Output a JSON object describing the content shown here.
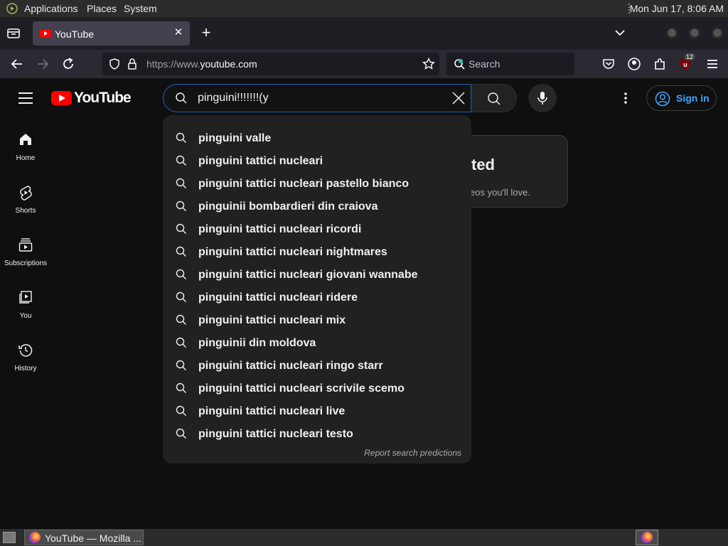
{
  "top_panel": {
    "menus": [
      "Applications",
      "Places",
      "System"
    ],
    "clock": "Mon Jun 17,  8:06 AM"
  },
  "browser": {
    "tab_title": "YouTube",
    "url_prefix": "https://www.",
    "url_domain": "youtube.com",
    "search_placeholder": "Search",
    "extension_badge": "12"
  },
  "youtube": {
    "logo_text": "YouTube",
    "search_value": "pinguini!!!!!!!(y",
    "sign_in_label": "Sign in",
    "sidebar": [
      {
        "label": "Home",
        "icon": "home-icon"
      },
      {
        "label": "Shorts",
        "icon": "shorts-icon"
      },
      {
        "label": "Subscriptions",
        "icon": "subscriptions-icon"
      },
      {
        "label": "You",
        "icon": "you-icon"
      },
      {
        "label": "History",
        "icon": "history-icon"
      }
    ],
    "card": {
      "heading_fragment": "ted",
      "text_fragment": "eos you'll love."
    },
    "suggestions": [
      "pinguini valle",
      "pinguini tattici nucleari",
      "pinguini tattici nucleari pastello bianco",
      "pinguinii bombardieri din craiova",
      "pinguini tattici nucleari ricordi",
      "pinguini tattici nucleari nightmares",
      "pinguini tattici nucleari giovani wannabe",
      "pinguini tattici nucleari ridere",
      "pinguini tattici nucleari mix",
      "pinguinii din moldova",
      "pinguini tattici nucleari ringo starr",
      "pinguini tattici nucleari scrivile scemo",
      "pinguini tattici nucleari live",
      "pinguini tattici nucleari testo"
    ],
    "report_link": "Report search predictions"
  },
  "taskbar": {
    "window_label": "YouTube — Mozilla ..."
  },
  "colors": {
    "youtube_red": "#ff0000",
    "link_blue": "#3ea6ff",
    "focus_blue": "#1c62b9",
    "page_bg": "#0f0f0f"
  }
}
